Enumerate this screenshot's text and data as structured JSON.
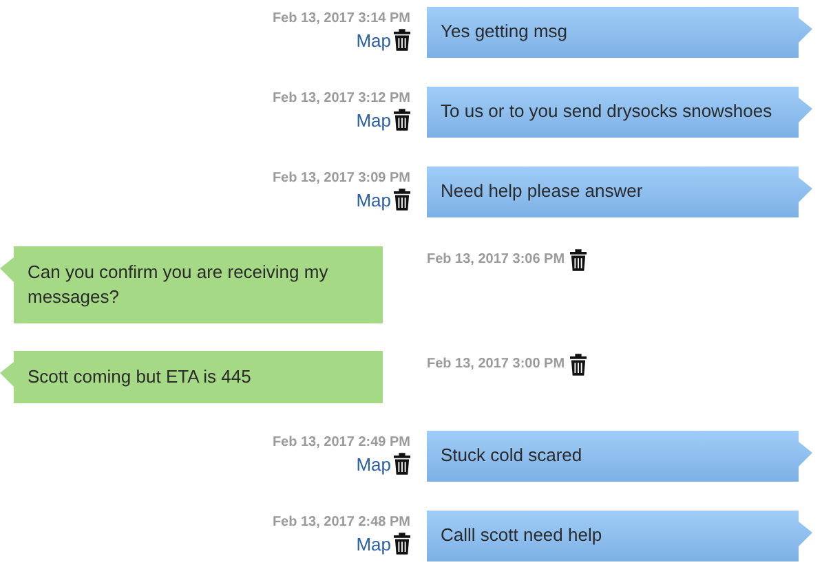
{
  "messages": [
    {
      "kind": "sent",
      "time": "Feb 13, 2017 3:14 PM",
      "map": "Map",
      "text": "Yes getting msg"
    },
    {
      "kind": "sent",
      "time": "Feb 13, 2017 3:12 PM",
      "map": "Map",
      "text": "To us or to you send drysocks snowshoes"
    },
    {
      "kind": "sent",
      "time": "Feb 13, 2017 3:09 PM",
      "map": "Map",
      "text": "Need help please answer"
    },
    {
      "kind": "received",
      "time": "Feb 13, 2017 3:06 PM",
      "text": "Can you confirm you are receiving my messages?"
    },
    {
      "kind": "received",
      "time": "Feb 13, 2017 3:00 PM",
      "text": "Scott coming but ETA is 445"
    },
    {
      "kind": "sent",
      "time": "Feb 13, 2017 2:49 PM",
      "map": "Map",
      "text": "Stuck cold scared"
    },
    {
      "kind": "sent",
      "time": "Feb 13, 2017 2:48 PM",
      "map": "Map",
      "text": "Calll scott need help"
    }
  ]
}
